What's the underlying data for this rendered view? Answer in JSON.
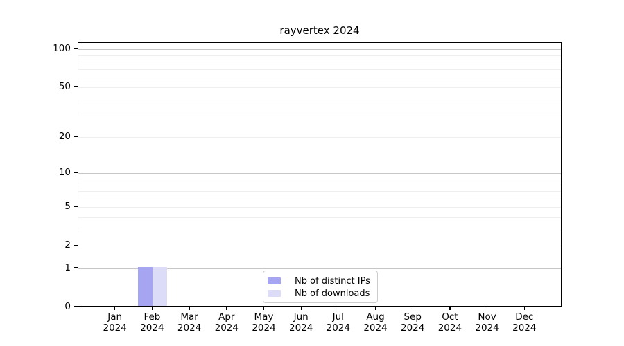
{
  "title": "rayvertex 2024",
  "chart_data": {
    "type": "bar",
    "title": "rayvertex 2024",
    "xlabel": "",
    "ylabel": "",
    "year": "2024",
    "categories": [
      "Jan",
      "Feb",
      "Mar",
      "Apr",
      "May",
      "Jun",
      "Jul",
      "Aug",
      "Sep",
      "Oct",
      "Nov",
      "Dec"
    ],
    "series": [
      {
        "name": "Nb of distinct IPs",
        "color": "#a5a5f2",
        "values": [
          0,
          1,
          0,
          0,
          0,
          0,
          0,
          0,
          0,
          0,
          0,
          0
        ]
      },
      {
        "name": "Nb of downloads",
        "color": "#dcdcf8",
        "values": [
          0,
          1,
          0,
          0,
          0,
          0,
          0,
          0,
          0,
          0,
          0,
          0
        ]
      }
    ],
    "y_axis": {
      "scale": "log1p",
      "tick_values": [
        0,
        1,
        2,
        5,
        10,
        20,
        50,
        100
      ],
      "ylim": [
        0,
        112
      ]
    },
    "grid": {
      "major_values": [
        1,
        10,
        100
      ],
      "minor_values": [
        2,
        3,
        4,
        5,
        6,
        7,
        8,
        9,
        20,
        30,
        40,
        50,
        60,
        70,
        80,
        90
      ],
      "major_color": "#c6c6c6",
      "minor_color": "#eeeeee"
    },
    "legend": {
      "position": "inside-bottom-center",
      "entries": [
        "Nb of distinct IPs",
        "Nb of downloads"
      ]
    }
  },
  "colors": {
    "spine": "#000000",
    "background": "#ffffff",
    "text": "#000000"
  }
}
